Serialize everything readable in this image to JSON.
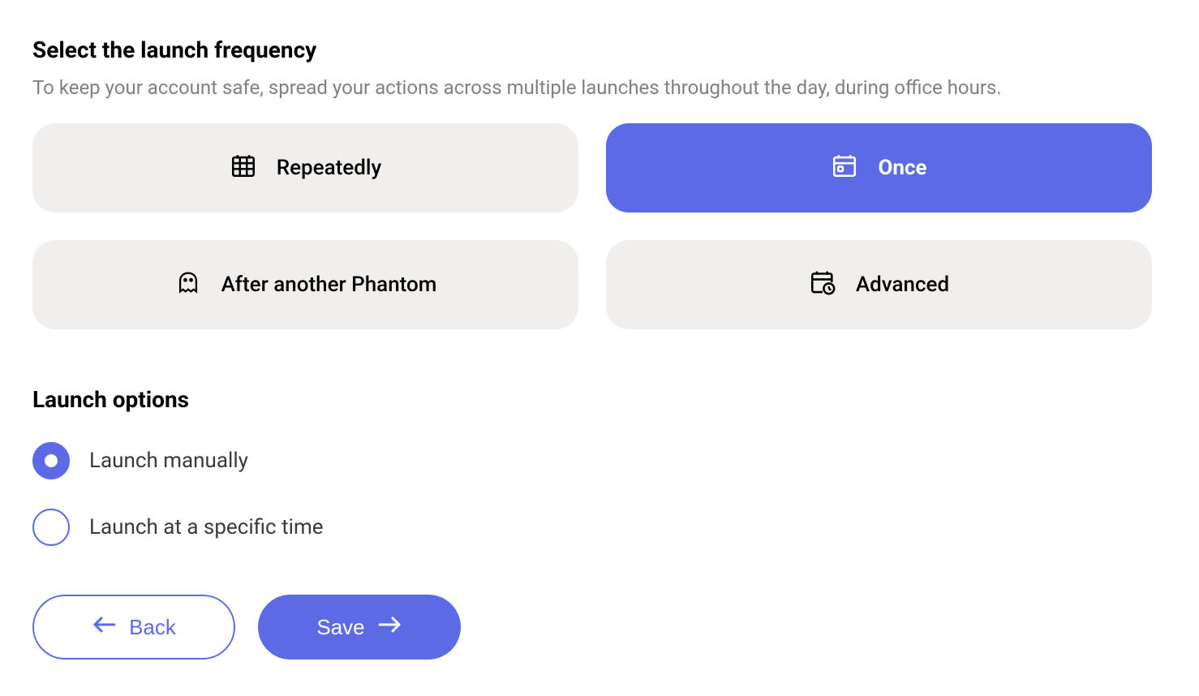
{
  "heading": "Select the launch frequency",
  "subheading": "To keep your account safe, spread your actions across multiple launches throughout the day, during office hours.",
  "frequency": {
    "options": [
      {
        "label": "Repeatedly",
        "selected": false
      },
      {
        "label": "Once",
        "selected": true
      },
      {
        "label": "After another Phantom",
        "selected": false
      },
      {
        "label": "Advanced",
        "selected": false
      }
    ]
  },
  "launch_options": {
    "title": "Launch options",
    "items": [
      {
        "label": "Launch manually",
        "checked": true
      },
      {
        "label": "Launch at a specific time",
        "checked": false
      }
    ]
  },
  "buttons": {
    "back": "Back",
    "save": "Save"
  }
}
